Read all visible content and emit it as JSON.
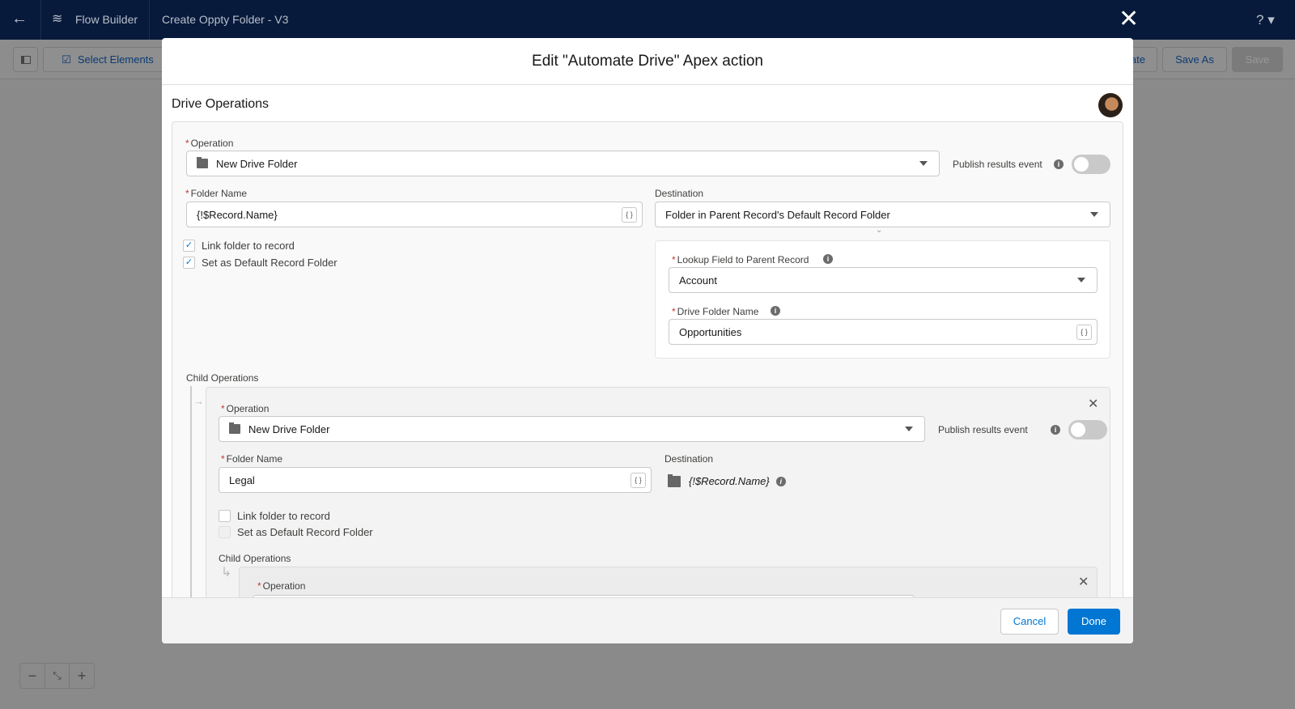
{
  "nav": {
    "back_icon": "arrow-left-icon",
    "app_icon": "flow-icon",
    "app_name": "Flow Builder",
    "flow_title": "Create Oppty Folder - V3",
    "help": "?",
    "close_icon": "close-icon"
  },
  "toolbar": {
    "select_elements": "Select Elements",
    "activate": "Activate",
    "save_as": "Save As",
    "save": "Save"
  },
  "modal": {
    "title": "Edit \"Automate Drive\" Apex action",
    "section_title": "Drive Operations",
    "op": {
      "label": "Operation",
      "value": "New Drive Folder",
      "publish_label": "Publish results event",
      "publish_on": false,
      "folder_name_label": "Folder Name",
      "folder_name": "{!$Record.Name}",
      "destination_label": "Destination",
      "destination": "Folder in Parent Record's Default Record Folder",
      "link_label": "Link folder to record",
      "link_checked": true,
      "default_label": "Set as Default Record Folder",
      "default_checked": true,
      "lookup_label": "Lookup Field to Parent Record",
      "lookup_value": "Account",
      "drive_folder_label": "Drive Folder Name",
      "drive_folder_value": "Opportunities"
    },
    "child_label": "Child Operations",
    "child": {
      "label": "Operation",
      "value": "New Drive Folder",
      "publish_label": "Publish results event",
      "publish_on": false,
      "folder_name_label": "Folder Name",
      "folder_name": "Legal",
      "destination_label": "Destination",
      "destination": "{!$Record.Name}",
      "link_label": "Link folder to record",
      "link_checked": false,
      "default_label": "Set as Default Record Folder",
      "default_checked": false,
      "child_label": "Child Operations",
      "grandchild_op_label": "Operation"
    },
    "merge_glyph": "{ }",
    "cancel": "Cancel",
    "done": "Done"
  },
  "colors": {
    "brand": "#0176d3",
    "nav": "#071a3b",
    "required": "#c23934"
  }
}
